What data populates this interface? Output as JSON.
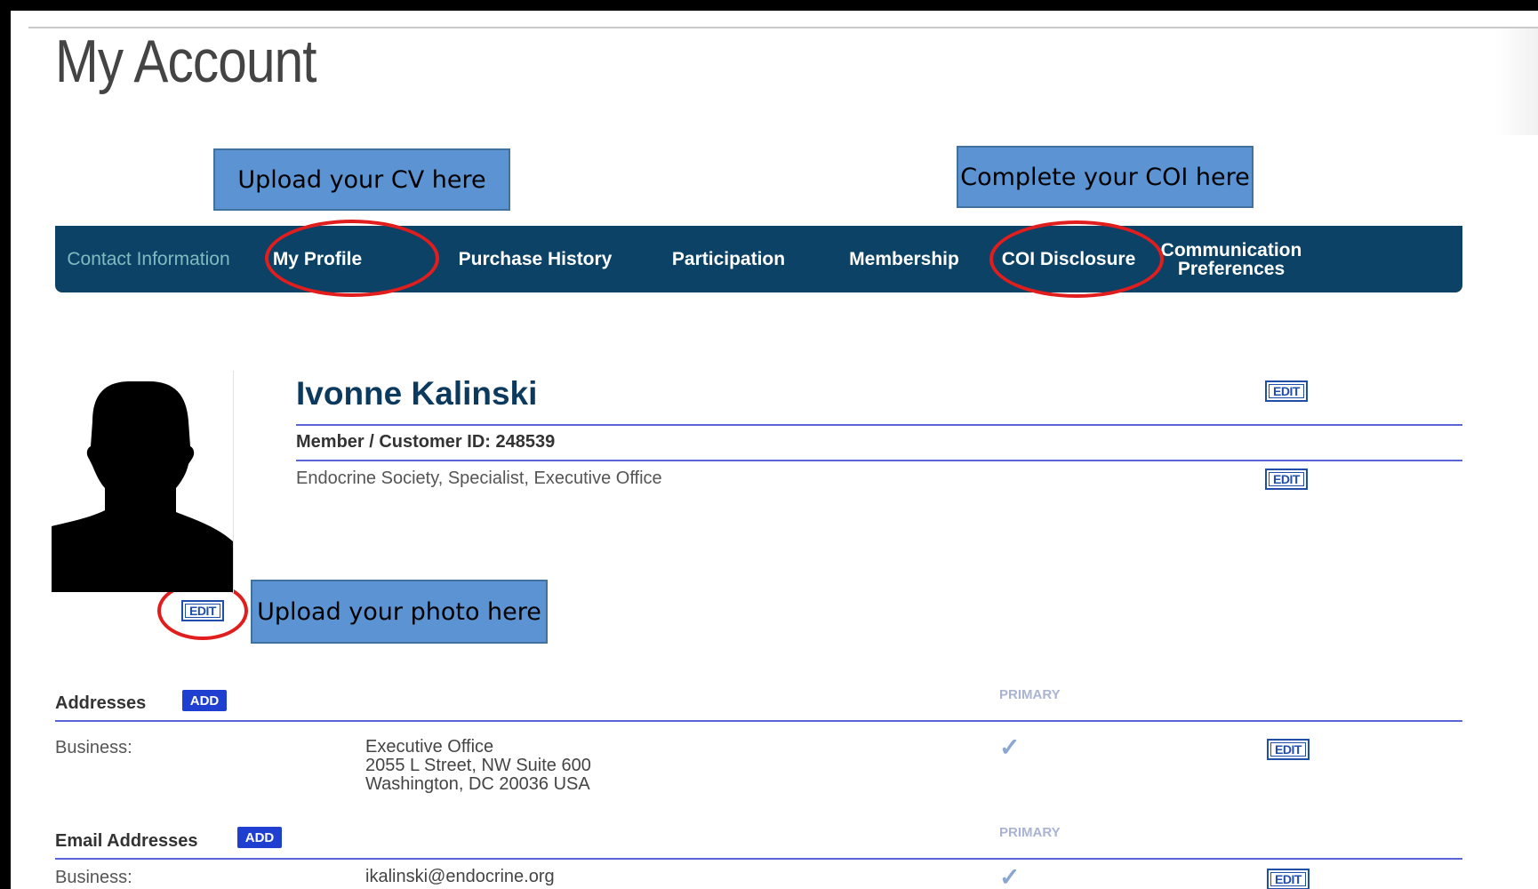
{
  "page": {
    "title": "My Account"
  },
  "callouts": {
    "cv": "Upload your CV here",
    "coi": "Complete your COI here",
    "photo": "Upload your photo here"
  },
  "nav": {
    "items": [
      {
        "label": "Contact Information",
        "active": true
      },
      {
        "label": "My Profile"
      },
      {
        "label": "Purchase History"
      },
      {
        "label": "Participation"
      },
      {
        "label": "Membership"
      },
      {
        "label": "COI Disclosure"
      },
      {
        "label": "Communication Preferences"
      }
    ]
  },
  "profile": {
    "name": "Ivonne Kalinski",
    "member_id": "Member / Customer ID: 248539",
    "organization": "Endocrine Society, Specialist, Executive Office",
    "edit_label": "EDIT"
  },
  "addresses": {
    "title": "Addresses",
    "add_label": "ADD",
    "primary_label": "PRIMARY",
    "rows": [
      {
        "type": "Business:",
        "line1": "Executive Office",
        "line2": "2055 L Street, NW Suite 600",
        "line3": "Washington, DC 20036 USA",
        "primary_mark": "✓",
        "edit_label": "EDIT"
      }
    ]
  },
  "emails": {
    "title": "Email Addresses",
    "add_label": "ADD",
    "primary_label": "PRIMARY",
    "rows": [
      {
        "type": "Business:",
        "value": "ikalinski@endocrine.org",
        "primary_mark": "✓",
        "edit_label": "EDIT"
      }
    ]
  },
  "colors": {
    "nav_bg": "#0c4266",
    "nav_active_text": "#7fbbc0",
    "callout_bg": "#5b93d3",
    "highlight_ring": "#e21d1d",
    "divider": "#5a63d8",
    "add_button": "#1f3fd0"
  },
  "icons": {
    "avatar": "person-silhouette-icon",
    "primary": "checkmark-icon"
  }
}
